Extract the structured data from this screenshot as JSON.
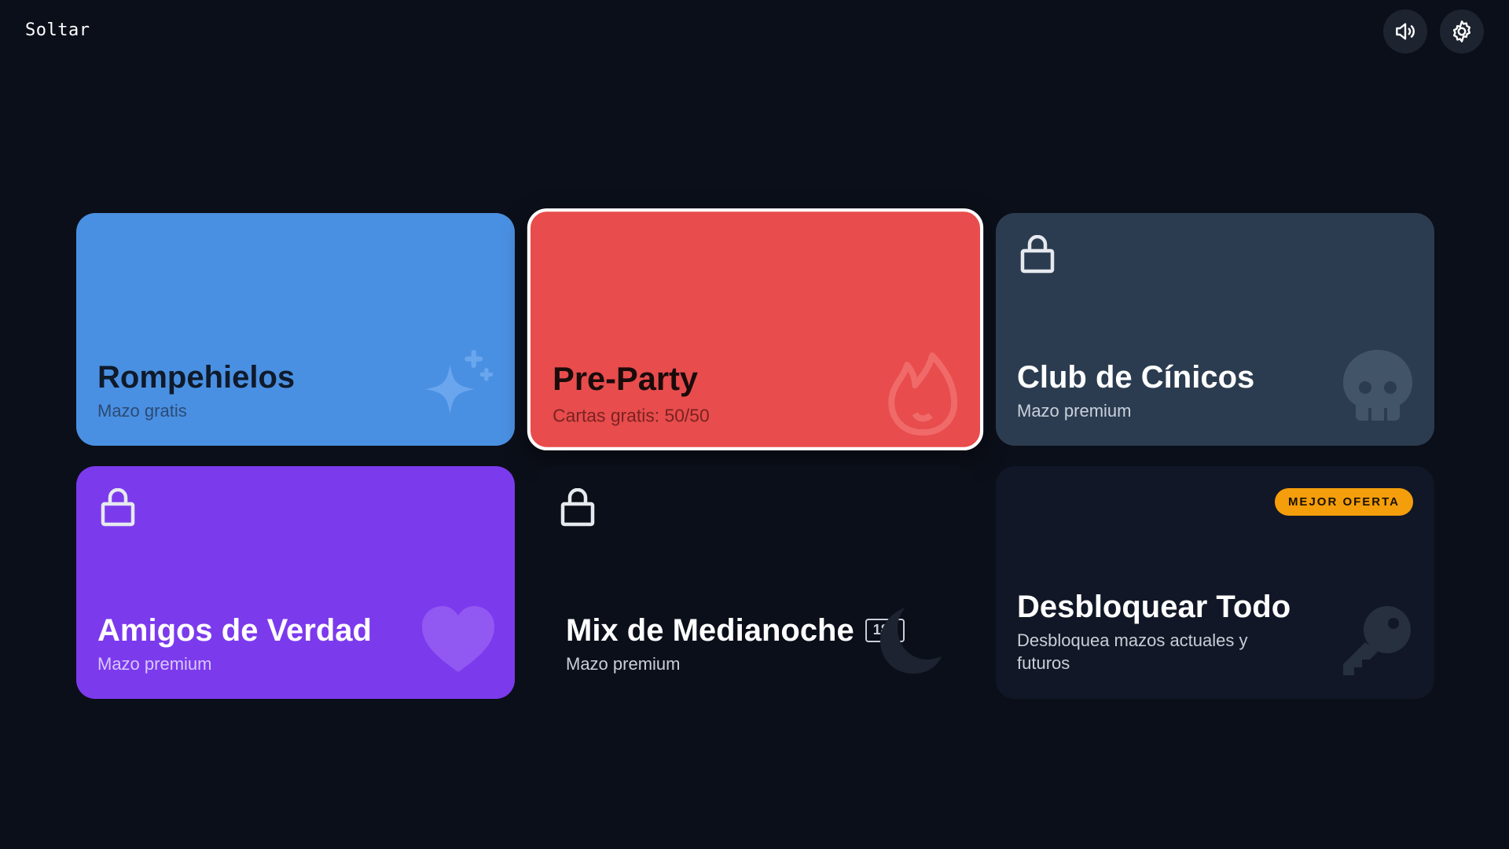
{
  "app": {
    "brand": "Soltar"
  },
  "toolbar": {
    "sound_icon": "speaker-icon",
    "settings_icon": "gear-icon"
  },
  "decks": [
    {
      "title": "Rompehielos",
      "subtitle": "Mazo gratis",
      "color": "#4a90e2",
      "icon": "sparkles-icon",
      "locked": false
    },
    {
      "title": "Pre-Party",
      "subtitle": "Cartas gratis: 50/50",
      "color": "#e84c4c",
      "icon": "flame-icon",
      "locked": false,
      "selected": true
    },
    {
      "title": "Club de Cínicos",
      "subtitle": "Mazo premium",
      "color": "#2c3c50",
      "icon": "skull-icon",
      "locked": true
    },
    {
      "title": "Amigos de Verdad",
      "subtitle": "Mazo premium",
      "color": "#7c3aed",
      "icon": "heart-icon",
      "locked": true
    },
    {
      "title": "Mix de Medianoche",
      "badge": "18+",
      "subtitle": "Mazo premium",
      "color": "#0b0f19",
      "icon": "moon-icon",
      "locked": true
    },
    {
      "title": "Desbloquear Todo",
      "subtitle": "Desbloquea mazos actuales y futuros",
      "offer": "MEJOR OFERTA",
      "color": "#111726",
      "icon": "key-icon"
    }
  ],
  "colors": {
    "background": "#0b0f19",
    "offer_badge": "#f59e0b"
  }
}
